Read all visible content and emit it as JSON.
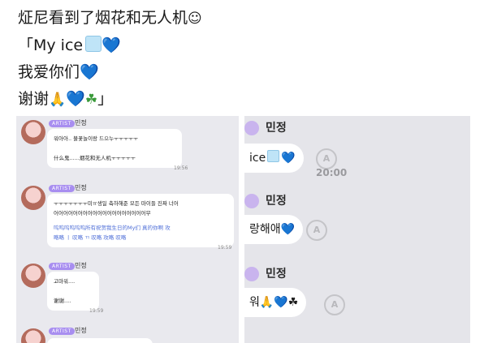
{
  "caption": {
    "line1_text": "炡尼看到了烟花和无人机",
    "line1_emoji": "☺",
    "line2_text": "「My ice",
    "line2_heart": "💙",
    "line3_text": "我爱你们",
    "line3_heart": "💙",
    "line4_text": "谢谢",
    "line4_pray": "🙏",
    "line4_heart": "💙",
    "line4_clover": "☘",
    "line4_end": "」"
  },
  "left_panel": {
    "messages": [
      {
        "badge": "ARTIST",
        "sender": "민정",
        "lines": [
          "워아아.. 불꽃놀이랑 드으누ㅜㅜㅜㅜㅜ",
          "",
          "什么鬼......烟花和无人机ㅜㅜㅜㅜㅜ"
        ],
        "time": "19:56"
      },
      {
        "badge": "ARTIST",
        "sender": "민정",
        "lines": [
          "ㅜㅜㅜㅜㅜㅜㅜ미ㅠ생일 축하해준 모든 마이들 진짜 너어",
          "어어어어어어어어어어어어어어어어어어어무"
        ],
        "translation": [
          "呜呜呜呜呜呜所有祝贺我生日的My们 真的你啊 攻",
          "略略 ㅣ 叹略 ㄲ 叹略 攻略 叹略"
        ],
        "time": "19:59"
      },
      {
        "badge": "ARTIST",
        "sender": "민정",
        "lines": [
          "고마워....",
          "",
          "谢谢...."
        ],
        "time": "19:59"
      },
      {
        "badge": "ARTIST",
        "sender": "민정"
      }
    ]
  },
  "right_panel": {
    "rows": [
      {
        "sender": "민정",
        "text": "ice",
        "heart": "💙",
        "time": "20:00",
        "read_icon": "A"
      },
      {
        "sender": "민정",
        "text": "랑해애",
        "heart": "💙",
        "time": "",
        "read_icon": "A"
      },
      {
        "sender": "민정",
        "text": "워",
        "emojis": "🙏💙☘",
        "time": "",
        "read_icon": "A"
      }
    ]
  },
  "colors": {
    "heart": "#2f8fe8",
    "artist_badge": "#a88ef0",
    "panel_bg": "#e9e9ee"
  }
}
